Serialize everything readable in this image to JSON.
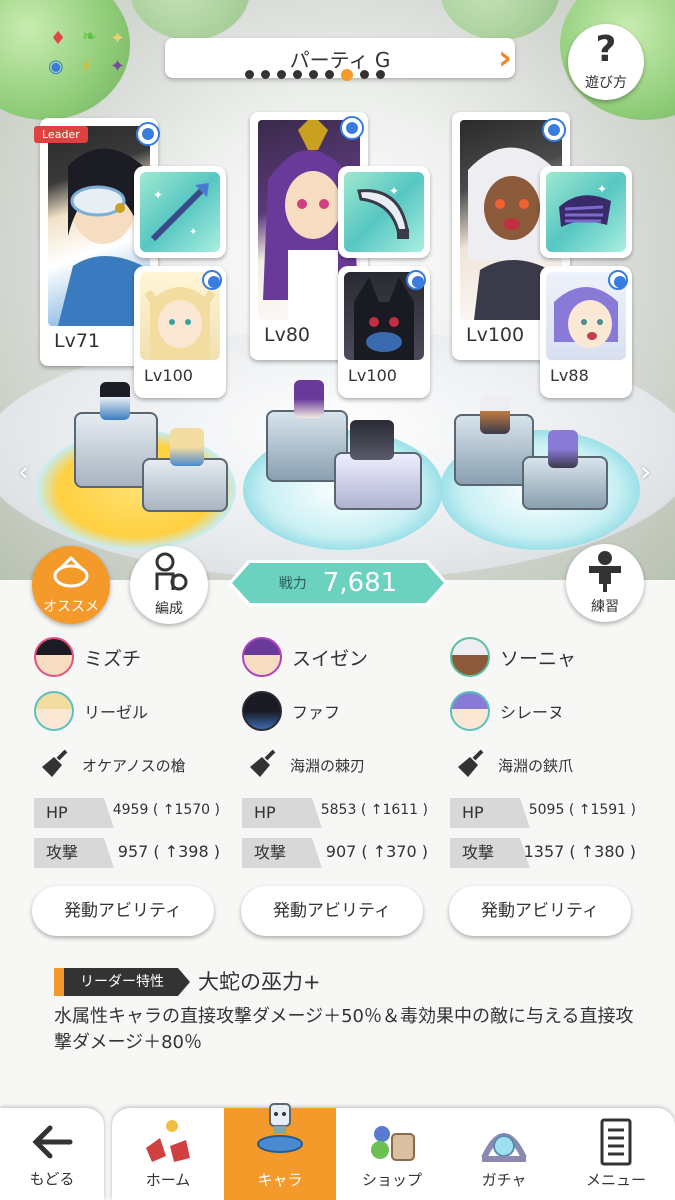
{
  "header": {
    "party_title": "パーティ G",
    "party_dots": [
      false,
      false,
      false,
      false,
      false,
      false,
      true,
      false,
      false
    ],
    "help_label": "遊び方"
  },
  "members": [
    {
      "name": "ミズチ",
      "level": "Lv71",
      "leader_badge": "Leader",
      "sub_name": "リーゼル",
      "sub_level": "Lv100",
      "weapon": "オケアノスの槍",
      "hp_label": "HP",
      "hp": "4959 ( ↑1570 )",
      "atk_label": "攻撃",
      "atk": "957 ( ↑398 )",
      "ability_label": "発動アビリティ"
    },
    {
      "name": "スイゼン",
      "level": "Lv80",
      "sub_name": "ファフ",
      "sub_level": "Lv100",
      "weapon": "海淵の棘刃",
      "hp_label": "HP",
      "hp": "5853 ( ↑1611 )",
      "atk_label": "攻撃",
      "atk": "907 ( ↑370 )",
      "ability_label": "発動アビリティ"
    },
    {
      "name": "ソーニャ",
      "level": "Lv100",
      "sub_name": "シレーヌ",
      "sub_level": "Lv88",
      "weapon": "海淵の鋏爪",
      "hp_label": "HP",
      "hp": "5095 ( ↑1591 )",
      "atk_label": "攻撃",
      "atk": "1357 ( ↑380 )",
      "ability_label": "発動アビリティ"
    }
  ],
  "controls": {
    "recommend_label": "オススメ",
    "formation_label": "編成",
    "power_label": "戦力",
    "power_value": "7,681",
    "practice_label": "練習"
  },
  "leader_skill": {
    "tag": "リーダー特性",
    "name": "大蛇の巫力+",
    "description": "水属性キャラの直接攻撃ダメージ＋50％＆毒効果中の敵に与える直接攻撃ダメージ＋80％"
  },
  "nav": {
    "back": "もどる",
    "items": [
      "ホーム",
      "キャラ",
      "ショップ",
      "ガチャ",
      "メニュー"
    ],
    "active_index": 1
  },
  "colors": {
    "accent": "#f39a2a",
    "power": "#6cd2c0",
    "badge": "#3a7be0"
  }
}
